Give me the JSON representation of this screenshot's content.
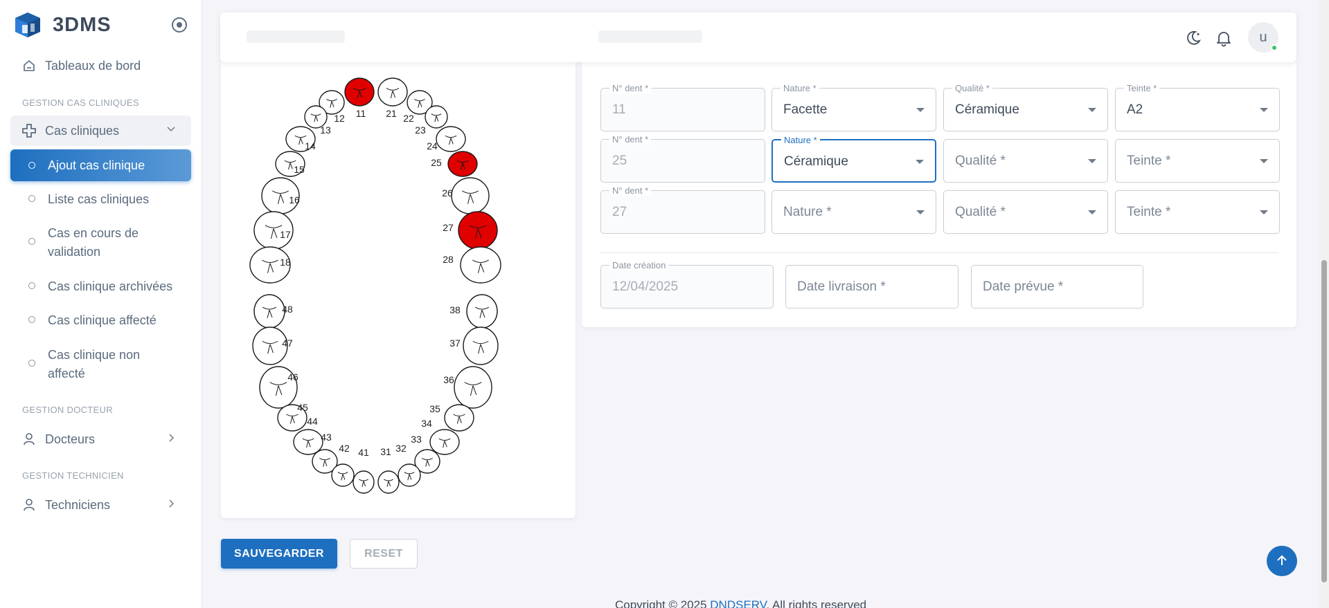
{
  "brand": {
    "name": "3DMS"
  },
  "sidebar": {
    "dashboard": "Tableaux de bord",
    "section_cas": "GESTION CAS CLINIQUES",
    "group_cas": "Cas cliniques",
    "sub_items": [
      "Ajout cas clinique",
      "Liste cas cliniques",
      "Cas en cours de validation",
      "Cas clinique archivées",
      "Cas clinique affecté",
      "Cas clinique non affecté"
    ],
    "section_docteur": "GESTION DOCTEUR",
    "docteurs": "Docteurs",
    "section_tech": "GESTION TECHNICIEN",
    "techniciens": "Techniciens"
  },
  "navbar": {
    "avatar_letter": "u"
  },
  "chart": {
    "selected_teeth": [
      "11",
      "25",
      "27"
    ],
    "teeth_labels": [
      "11",
      "12",
      "13",
      "14",
      "15",
      "16",
      "17",
      "18",
      "21",
      "22",
      "23",
      "24",
      "25",
      "26",
      "27",
      "28",
      "48",
      "47",
      "46",
      "45",
      "44",
      "43",
      "42",
      "41",
      "31",
      "32",
      "33",
      "34",
      "35",
      "36",
      "37",
      "38"
    ]
  },
  "form": {
    "rows": [
      {
        "dent_label": "N° dent *",
        "dent_value": "11",
        "nature_label": "Nature *",
        "nature_value": "Facette",
        "qualite_label": "Qualité *",
        "qualite_value": "Céramique",
        "teinte_label": "Teinte *",
        "teinte_value": "A2"
      },
      {
        "dent_label": "N° dent *",
        "dent_value": "25",
        "nature_label": "Nature *",
        "nature_value": "Céramique",
        "qualite_placeholder": "Qualité *",
        "teinte_placeholder": "Teinte *"
      },
      {
        "dent_label": "N° dent *",
        "dent_value": "27",
        "nature_placeholder": "Nature *",
        "qualite_placeholder": "Qualité *",
        "teinte_placeholder": "Teinte *"
      }
    ],
    "date_creation_label": "Date création",
    "date_creation_value": "12/04/2025",
    "date_livraison_placeholder": "Date livraison *",
    "date_prevue_placeholder": "Date prévue *"
  },
  "buttons": {
    "save": "SAUVEGARDER",
    "reset": "RESET"
  },
  "footer": {
    "prefix": "Copyright © 2025 ",
    "link": "DNDSERV",
    "suffix": ". All rights reserved"
  },
  "colors": {
    "accent": "#1e6fc0",
    "selected_tooth": "#e00000"
  }
}
